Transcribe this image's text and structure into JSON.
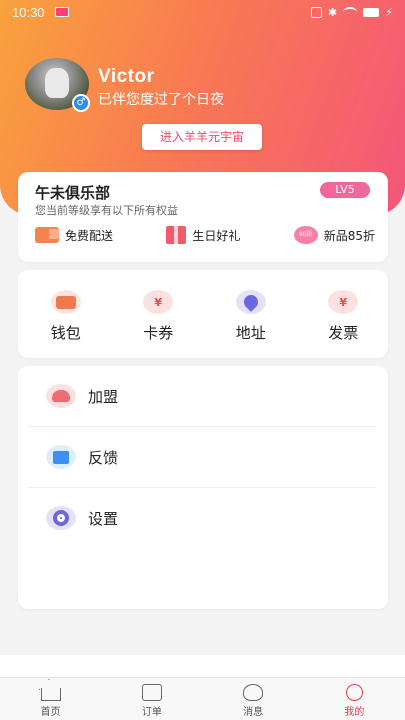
{
  "status_bar": {
    "time": "10:30"
  },
  "profile": {
    "username": "Victor",
    "companion_text": "已伴您度过了个日夜",
    "gender_symbol": "♂",
    "metaverse_button": "进入羊羊元宇宙"
  },
  "club": {
    "title": "午未俱乐部",
    "subtitle": "您当前等级享有以下所有权益",
    "level": "LV5",
    "perks": [
      {
        "icon": "delivery-truck-icon",
        "label": "免费配送"
      },
      {
        "icon": "gift-icon",
        "label": "生日好礼"
      },
      {
        "icon": "discount-90-icon",
        "icon_text": "90折",
        "label": "新品85折"
      }
    ]
  },
  "quick_actions": [
    {
      "icon": "wallet-icon",
      "label": "钱包"
    },
    {
      "icon": "coupon-icon",
      "icon_text": "¥",
      "label": "卡券"
    },
    {
      "icon": "address-icon",
      "label": "地址"
    },
    {
      "icon": "invoice-icon",
      "icon_text": "¥",
      "label": "发票"
    }
  ],
  "menu": [
    {
      "icon": "join-icon",
      "label": "加盟"
    },
    {
      "icon": "feedback-icon",
      "label": "反馈"
    },
    {
      "icon": "settings-icon",
      "label": "设置"
    }
  ],
  "tabs": [
    {
      "icon": "home-icon",
      "label": "首页"
    },
    {
      "icon": "order-icon",
      "label": "订单"
    },
    {
      "icon": "message-icon",
      "label": "消息"
    },
    {
      "icon": "mine-icon",
      "label": "我的",
      "active": true
    }
  ],
  "colors": {
    "header_gradient_start": "#f9a23d",
    "header_gradient_end": "#f4567a",
    "accent": "#e8394f",
    "level_badge": "#f0679a"
  }
}
